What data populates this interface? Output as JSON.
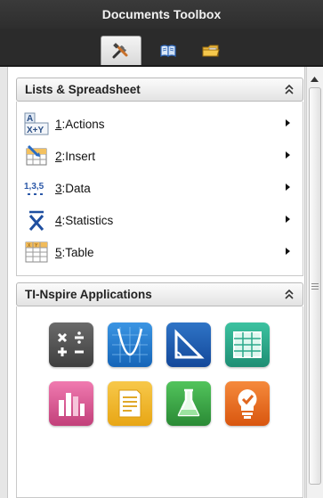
{
  "window": {
    "title": "Documents Toolbox"
  },
  "tabs": [
    {
      "name": "tools",
      "icon": "tools-icon",
      "active": true
    },
    {
      "name": "utilities",
      "icon": "book-icon",
      "active": false
    },
    {
      "name": "content",
      "icon": "folder-icon",
      "active": false
    }
  ],
  "sections": {
    "lists": {
      "title": "Lists & Spreadsheet",
      "items": [
        {
          "number": "1",
          "label": "Actions",
          "icon": "actions-icon"
        },
        {
          "number": "2",
          "label": "Insert",
          "icon": "insert-icon"
        },
        {
          "number": "3",
          "label": "Data",
          "icon": "data-icon",
          "icon_text": "1,3,5"
        },
        {
          "number": "4",
          "label": "Statistics",
          "icon": "statistics-icon"
        },
        {
          "number": "5",
          "label": "Table",
          "icon": "table-icon"
        }
      ]
    },
    "apps": {
      "title": "TI-Nspire Applications",
      "items": [
        {
          "name": "calculator",
          "icon": "calculator-icon",
          "color": "#555555"
        },
        {
          "name": "graphs",
          "icon": "graphs-icon",
          "color": "#1f7fd6"
        },
        {
          "name": "geometry",
          "icon": "geometry-icon",
          "color": "#1f5fb0"
        },
        {
          "name": "lists-spreadsheet",
          "icon": "spreadsheet-icon",
          "color": "#2aa98b"
        },
        {
          "name": "data-statistics",
          "icon": "data-statistics-icon",
          "color": "#c2407a"
        },
        {
          "name": "notes",
          "icon": "notes-icon",
          "color": "#f0b020"
        },
        {
          "name": "vernier-dataquest",
          "icon": "dataquest-icon",
          "color": "#3aa84a"
        },
        {
          "name": "question",
          "icon": "question-icon",
          "color": "#e8661e"
        }
      ]
    }
  },
  "colors": {
    "titlebar": "#2e2e2e",
    "header_gradient_end": "#e3e3e3"
  }
}
